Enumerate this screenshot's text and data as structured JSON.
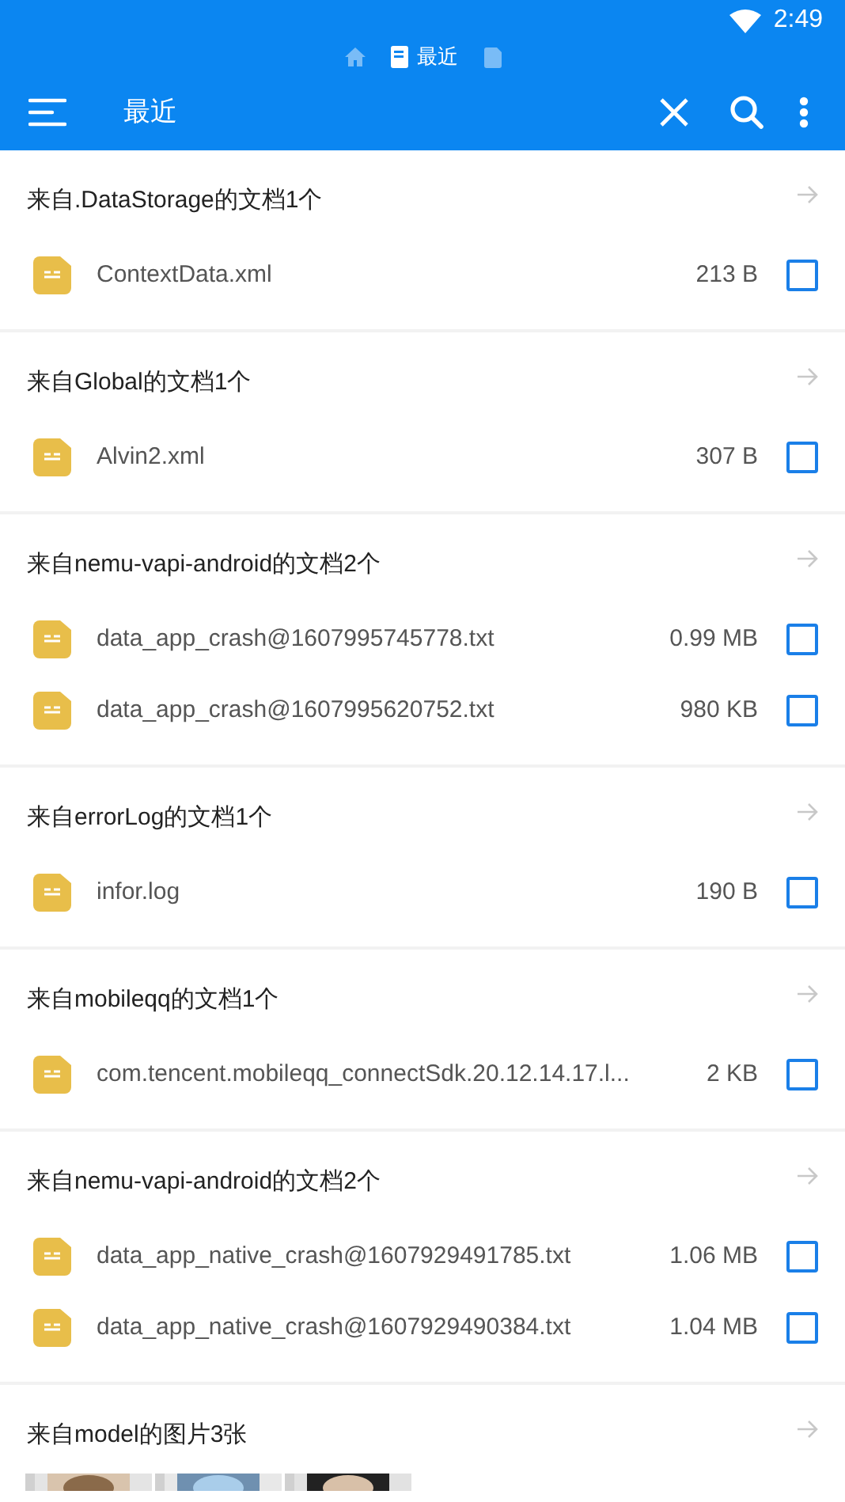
{
  "status_bar": {
    "time": "2:49"
  },
  "breadcrumb": {
    "items": [
      {
        "kind": "home",
        "selected": false
      },
      {
        "kind": "recent",
        "label": "最近",
        "selected": true
      },
      {
        "kind": "doc",
        "selected": false
      }
    ]
  },
  "toolbar": {
    "title": "最近"
  },
  "groups": [
    {
      "title": "来自.DataStorage的文档1个",
      "files": [
        {
          "name": "ContextData.xml",
          "size": "213 B",
          "checked": false
        }
      ]
    },
    {
      "title": "来自Global的文档1个",
      "files": [
        {
          "name": "Alvin2.xml",
          "size": "307 B",
          "checked": false
        }
      ]
    },
    {
      "title": "来自nemu-vapi-android的文档2个",
      "files": [
        {
          "name": "data_app_crash@1607995745778.txt",
          "size": "0.99 MB",
          "checked": false
        },
        {
          "name": "data_app_crash@1607995620752.txt",
          "size": "980 KB",
          "checked": false
        }
      ]
    },
    {
      "title": "来自errorLog的文档1个",
      "files": [
        {
          "name": "infor.log",
          "size": "190 B",
          "checked": false
        }
      ]
    },
    {
      "title": "来自mobileqq的文档1个",
      "files": [
        {
          "name": "com.tencent.mobileqq_connectSdk.20.12.14.17.l...",
          "size": "2 KB",
          "checked": false
        }
      ]
    },
    {
      "title": "来自nemu-vapi-android的文档2个",
      "files": [
        {
          "name": "data_app_native_crash@1607929491785.txt",
          "size": "1.06 MB",
          "checked": false
        },
        {
          "name": "data_app_native_crash@1607929490384.txt",
          "size": "1.04 MB",
          "checked": false
        }
      ]
    },
    {
      "title": "来自model的图片3张"
    }
  ]
}
